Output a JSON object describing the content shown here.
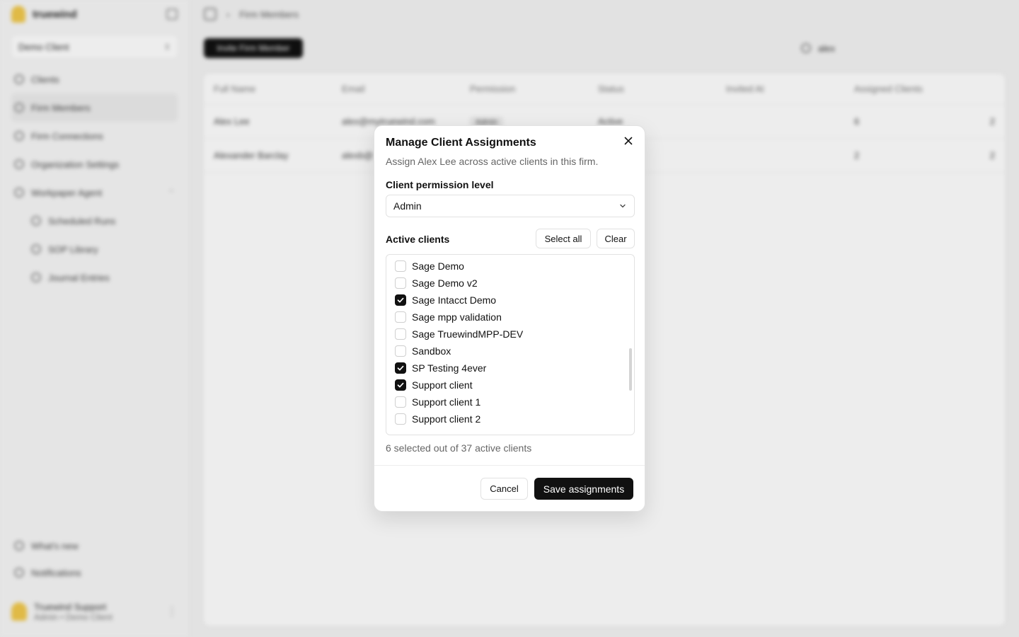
{
  "background": {
    "brand_name": "truewind",
    "client_select": "Demo Client",
    "nav_items": [
      "Clients",
      "Firm Members",
      "Firm Connections",
      "Organization Settings",
      "Workpaper Agent"
    ],
    "sub_items": [
      "Scheduled Runs",
      "SOP Library",
      "Journal Entries"
    ],
    "bottom_items": [
      "What's new",
      "Notifications"
    ],
    "profile_name": "Truewind Support",
    "profile_role": "Admin • Demo Client",
    "breadcrumb": "Firm Members",
    "invite_button": "Invite Firm Member",
    "search_value": "alex",
    "table_headers": [
      "Full Name",
      "Email",
      "Permission",
      "Status",
      "Invited At",
      "Assigned Clients"
    ],
    "rows": [
      {
        "name": "Alex Lee",
        "email": "alex@mytruewind.com",
        "permission": "Admin",
        "status": "Active",
        "invited": "",
        "assigned": "6",
        "count": "2"
      },
      {
        "name": "Alexander Barclay",
        "email": "alexb@",
        "permission": "",
        "status": "",
        "invited": "",
        "assigned": "2",
        "count": "2"
      }
    ]
  },
  "modal": {
    "title": "Manage Client Assignments",
    "description": "Assign Alex Lee across active clients in this firm.",
    "permission_label": "Client permission level",
    "permission_value": "Admin",
    "active_clients_label": "Active clients",
    "select_all_label": "Select all",
    "clear_label": "Clear",
    "clients": [
      {
        "label": "Sage Demo",
        "checked": false
      },
      {
        "label": "Sage Demo v2",
        "checked": false
      },
      {
        "label": "Sage Intacct Demo",
        "checked": true
      },
      {
        "label": "Sage mpp validation",
        "checked": false
      },
      {
        "label": "Sage TruewindMPP-DEV",
        "checked": false
      },
      {
        "label": "Sandbox",
        "checked": false
      },
      {
        "label": "SP Testing 4ever",
        "checked": true
      },
      {
        "label": "Support client",
        "checked": true
      },
      {
        "label": "Support client 1",
        "checked": false
      },
      {
        "label": "Support client 2",
        "checked": false
      }
    ],
    "summary": "6 selected out of 37 active clients",
    "cancel_label": "Cancel",
    "save_label": "Save assignments"
  },
  "colors": {
    "primary": "#111111",
    "border": "#e2e2e2",
    "muted_text": "#666666"
  }
}
